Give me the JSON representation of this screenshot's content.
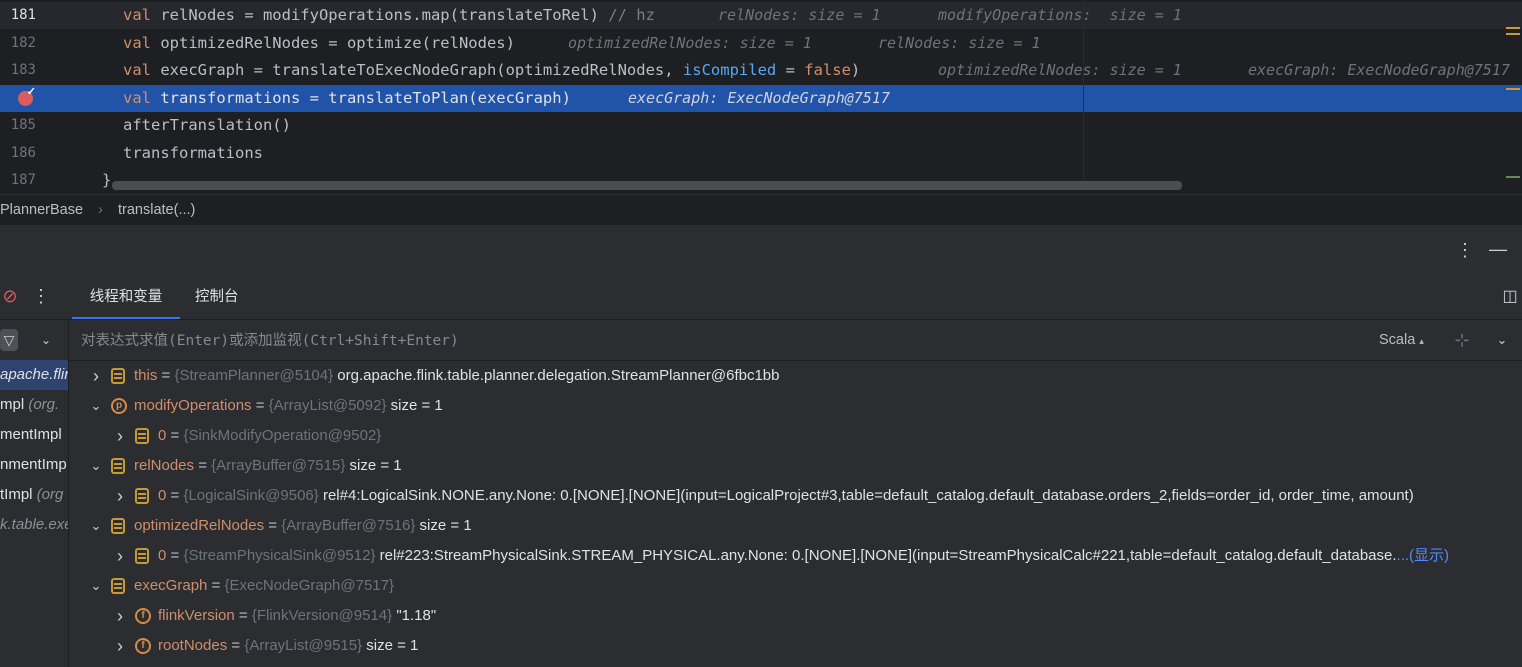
{
  "editor": {
    "lines": [
      {
        "num": "181",
        "segments": [
          [
            "kw",
            "val "
          ],
          [
            "",
            "relNodes = modifyOperations.map(translateToRel) "
          ],
          [
            "cm",
            "// hz"
          ]
        ],
        "hints": [
          "relNodes: size = 1",
          "modifyOperations:  size = 1"
        ]
      },
      {
        "num": "182",
        "segments": [
          [
            "kw",
            "val "
          ],
          [
            "",
            "optimizedRelNodes = optimize(relNodes)"
          ]
        ],
        "hints": [
          "optimizedRelNodes: size = 1",
          "relNodes: size = 1"
        ]
      },
      {
        "num": "183",
        "segments": [
          [
            "kw",
            "val "
          ],
          [
            "",
            "execGraph = translateToExecNodeGraph(optimizedRelNodes, "
          ],
          [
            "named",
            "isCompiled"
          ],
          [
            "",
            " = "
          ],
          [
            "kw",
            "false"
          ],
          [
            "",
            ")"
          ]
        ],
        "hints": [
          "optimizedRelNodes: size = 1",
          "execGraph: ExecNodeGraph@7517"
        ]
      },
      {
        "num": "",
        "segments": [
          [
            "kw",
            "val "
          ],
          [
            "",
            "transformations = translateToPlan(execGraph)"
          ]
        ],
        "hints": [
          "execGraph: ExecNodeGraph@7517"
        ]
      },
      {
        "num": "185",
        "segments": [
          [
            "",
            "afterTranslation()"
          ]
        ],
        "hints": []
      },
      {
        "num": "186",
        "segments": [
          [
            "",
            "transformations"
          ]
        ],
        "hints": []
      },
      {
        "num": "187",
        "segments": [
          [
            "",
            "}"
          ]
        ],
        "hints": []
      }
    ]
  },
  "breadcrumb": {
    "items": [
      "PlannerBase",
      "translate(...)"
    ],
    "separator": "›"
  },
  "panel": {
    "tabs": [
      "线程和变量",
      "控制台"
    ],
    "eval_placeholder": "对表达式求值(Enter)或添加监视(Ctrl+Shift+Enter)",
    "language": "Scala",
    "language_caret": "▴"
  },
  "frames": [
    {
      "main": "apache.flink.",
      "pkg": "",
      "selected": true
    },
    {
      "main": "mpl ",
      "pkg": "(org.",
      "selected": false
    },
    {
      "main": "mentImpl",
      "pkg": "",
      "selected": false
    },
    {
      "main": "nmentImp",
      "pkg": "",
      "selected": false
    },
    {
      "main": "tImpl ",
      "pkg": "(org",
      "selected": false
    },
    {
      "main": "",
      "pkg": "k.table.exe",
      "selected": false
    }
  ],
  "variables": [
    {
      "depth": 0,
      "expanded": false,
      "icon": "field",
      "name": "this",
      "type": "{StreamPlanner@5104}",
      "value": "org.apache.flink.table.planner.delegation.StreamPlanner@6fbc1bb",
      "link": ""
    },
    {
      "depth": 0,
      "expanded": true,
      "icon": "param",
      "name": "modifyOperations",
      "type": "{ArrayList@5092}",
      "value": " size = 1",
      "link": ""
    },
    {
      "depth": 1,
      "expanded": false,
      "icon": "field",
      "name": "0",
      "type": "{SinkModifyOperation@9502}",
      "value": "",
      "link": ""
    },
    {
      "depth": 0,
      "expanded": true,
      "icon": "field",
      "name": "relNodes",
      "type": "{ArrayBuffer@7515}",
      "value": "size = 1",
      "link": ""
    },
    {
      "depth": 1,
      "expanded": false,
      "icon": "field",
      "name": "0",
      "type": "{LogicalSink@9506}",
      "value": "rel#4:LogicalSink.NONE.any.None: 0.[NONE].[NONE](input=LogicalProject#3,table=default_catalog.default_database.orders_2,fields=order_id, order_time, amount)",
      "link": ""
    },
    {
      "depth": 0,
      "expanded": true,
      "icon": "field",
      "name": "optimizedRelNodes",
      "type": "{ArrayBuffer@7516}",
      "value": "size = 1",
      "link": ""
    },
    {
      "depth": 1,
      "expanded": false,
      "icon": "field",
      "name": "0",
      "type": "{StreamPhysicalSink@9512}",
      "value": "rel#223:StreamPhysicalSink.STREAM_PHYSICAL.any.None: 0.[NONE].[NONE](input=StreamPhysicalCalc#221,table=default_catalog.default_database.",
      "link": "...(显示)"
    },
    {
      "depth": 0,
      "expanded": true,
      "icon": "field",
      "name": "execGraph",
      "type": "{ExecNodeGraph@7517}",
      "value": "",
      "link": ""
    },
    {
      "depth": 1,
      "expanded": false,
      "icon": "final",
      "name": "flinkVersion",
      "type": "{FlinkVersion@9514}",
      "value": "\"1.18\"",
      "link": ""
    },
    {
      "depth": 1,
      "expanded": false,
      "icon": "final",
      "name": "rootNodes",
      "type": "{ArrayList@9515}",
      "value": " size = 1",
      "link": ""
    }
  ],
  "colors": {
    "accent": "#3574f0",
    "exec_line": "#2154a8",
    "breakpoint": "#db5c5c"
  },
  "icons": [
    "breakpoint-icon",
    "more-icon",
    "minimize-icon",
    "mute-breakpoints-icon",
    "filter-icon",
    "chevron-down-icon",
    "layout-icon",
    "add-watch-icon",
    "expand-icon",
    "collapse-icon",
    "field-icon",
    "parameter-icon"
  ]
}
